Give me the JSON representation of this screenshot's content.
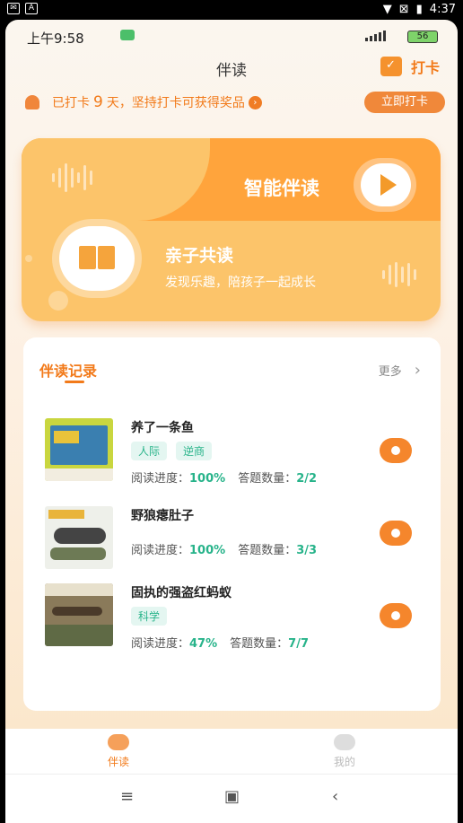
{
  "system_bar": {
    "time": "4:37"
  },
  "status": {
    "time": "上午9:58",
    "battery": "56"
  },
  "header": {
    "title": "伴读",
    "checkin_label": "打卡"
  },
  "notice": {
    "prefix": "已打卡",
    "days": "9",
    "suffix": "天，坚持打卡可获得奖品",
    "button": "立即打卡"
  },
  "banner": {
    "ai_title": "智能伴读",
    "parent_title": "亲子共读",
    "parent_subtitle": "发现乐趣，陪孩子一起成长"
  },
  "records": {
    "title": "伴读记录",
    "more": "更多",
    "progress_label": "阅读进度：",
    "answers_label": "答题数量：",
    "items": [
      {
        "name": "养了一条鱼",
        "tags": [
          "人际",
          "逆商"
        ],
        "progress": "100%",
        "answers": "2/2"
      },
      {
        "name": "野狼瘪肚子",
        "tags": [],
        "progress": "100%",
        "answers": "3/3"
      },
      {
        "name": "固执的强盗红蚂蚁",
        "tags": [
          "科学"
        ],
        "progress": "47%",
        "answers": "7/7"
      }
    ]
  },
  "tabs": [
    {
      "label": "伴读",
      "active": true
    },
    {
      "label": "我的",
      "active": false
    }
  ],
  "colors": {
    "accent": "#f27a1a",
    "teal": "#27b38a"
  }
}
